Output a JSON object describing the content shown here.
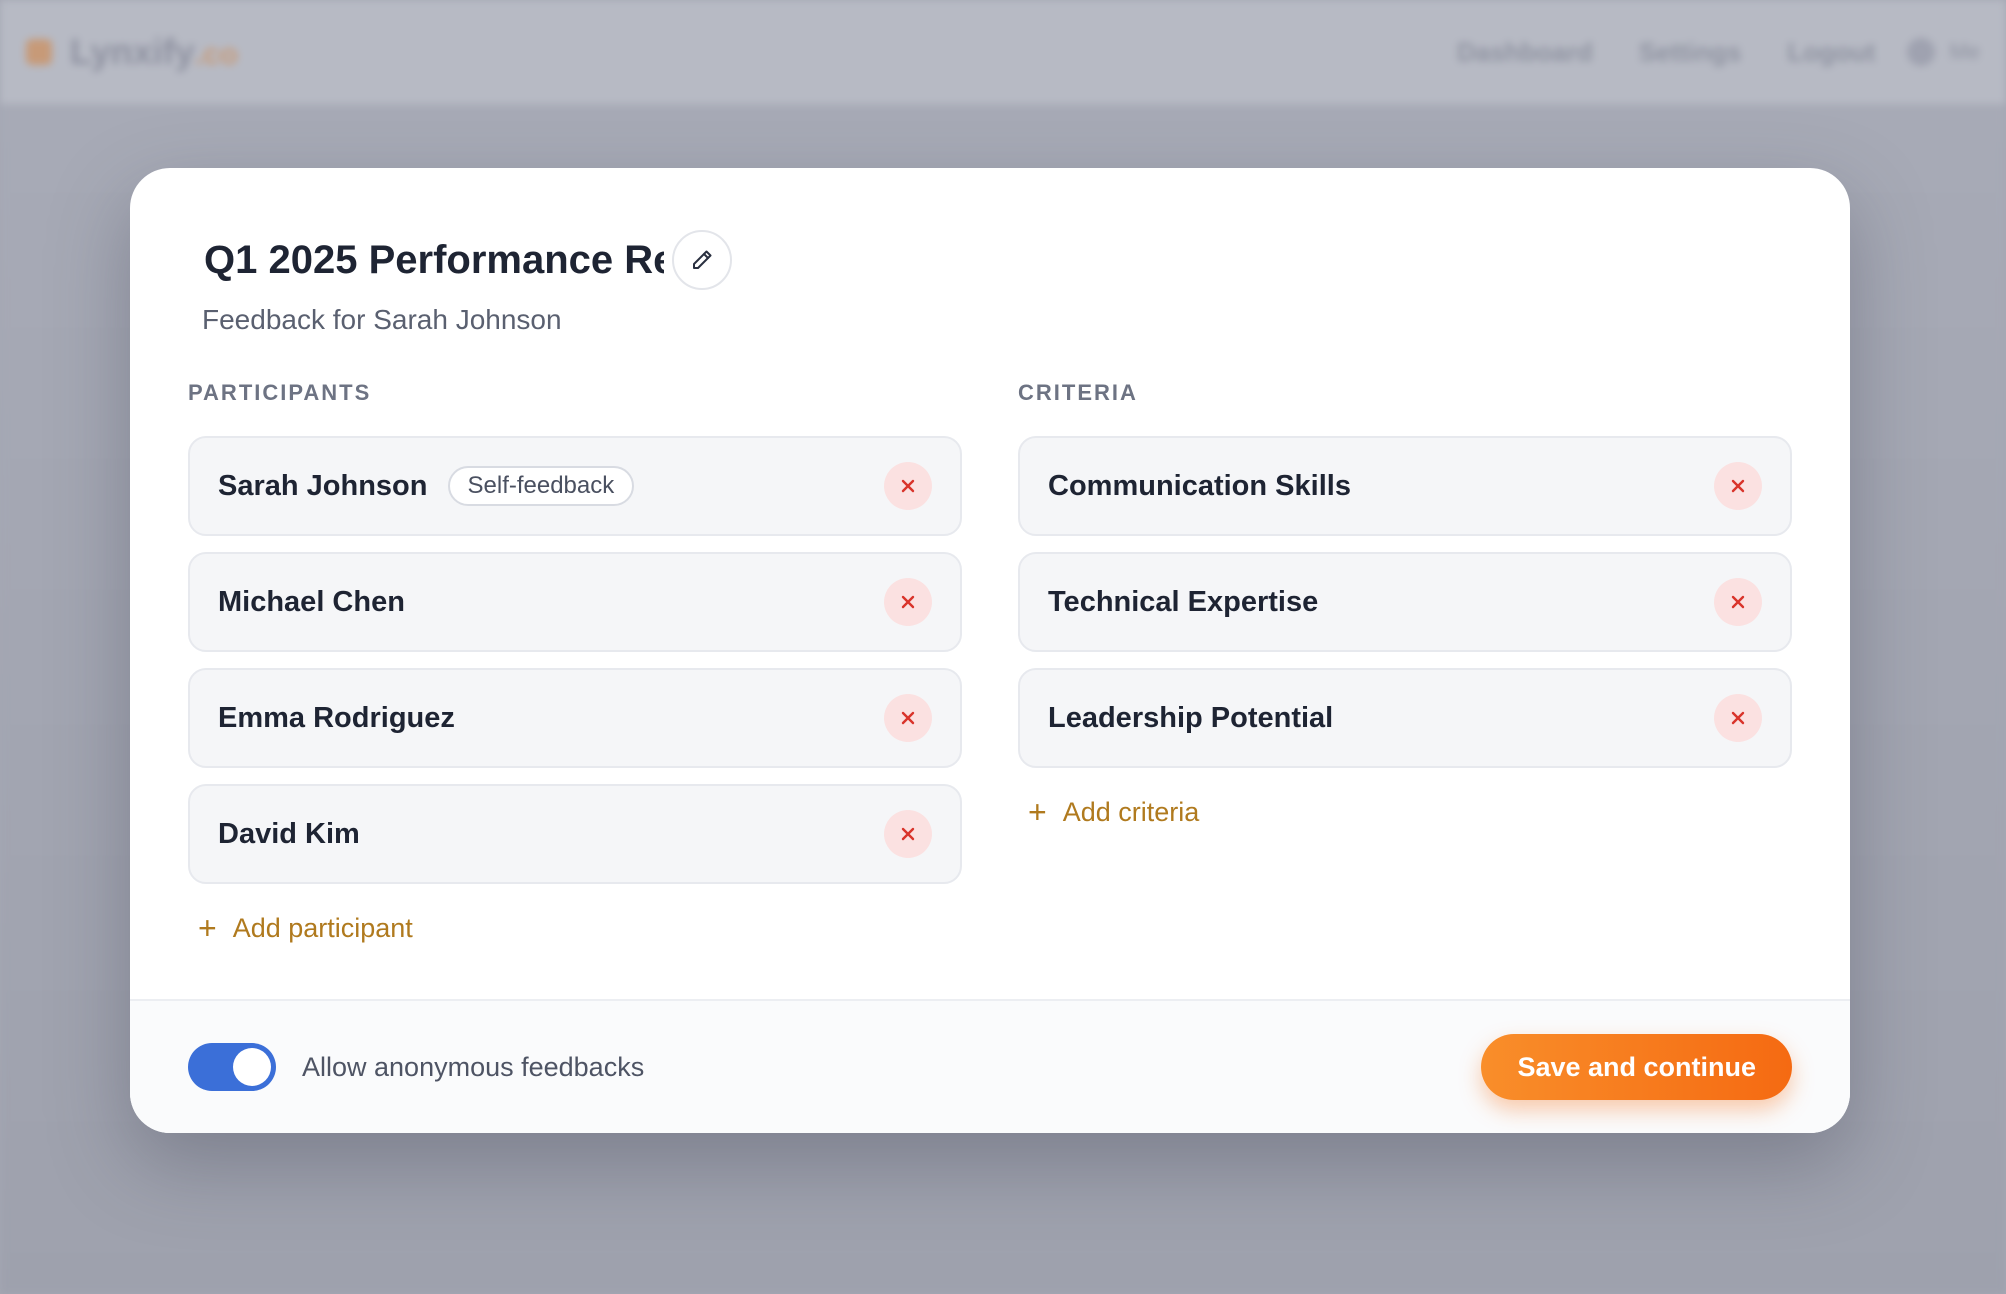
{
  "background": {
    "brand": "Lynxify",
    "brand_suffix": ".co",
    "nav_links": [
      "Dashboard",
      "Settings",
      "Logout"
    ],
    "user_label": "Me"
  },
  "modal": {
    "title": "Q1 2025 Performance Re",
    "subtitle": "Feedback for Sarah Johnson"
  },
  "participants": {
    "label": "PARTICIPANTS",
    "items": [
      {
        "name": "Sarah Johnson",
        "badge": "Self-feedback"
      },
      {
        "name": "Michael Chen"
      },
      {
        "name": "Emma Rodriguez"
      },
      {
        "name": "David Kim"
      }
    ],
    "add_label": "Add participant"
  },
  "criteria": {
    "label": "CRITERIA",
    "items": [
      {
        "name": "Communication Skills"
      },
      {
        "name": "Technical Expertise"
      },
      {
        "name": "Leadership Potential"
      }
    ],
    "add_label": "Add criteria"
  },
  "footer": {
    "toggle_label": "Allow anonymous feedbacks",
    "toggle_on": true,
    "save_label": "Save and continue"
  },
  "colors": {
    "accent": "#f57a1c",
    "toggle": "#3b6fd8",
    "add_link": "#b07a1e",
    "remove": "#d9342b"
  }
}
